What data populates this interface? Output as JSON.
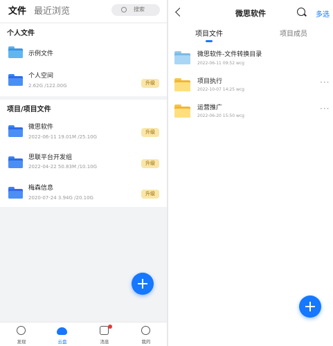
{
  "left": {
    "tabs": {
      "active": "文件",
      "inactive": "最近浏览"
    },
    "search": {
      "label": "搜索"
    },
    "personal": {
      "title": "个人文件",
      "items": [
        {
          "name": "示例文件"
        },
        {
          "name": "个人空间",
          "meta": "2.62G /122.00G",
          "badge": "升级"
        }
      ]
    },
    "projects": {
      "title": "项目/项目文件",
      "items": [
        {
          "name": "微思软件",
          "meta": "2022-06-11  19.01M /25.10G",
          "badge": "升级"
        },
        {
          "name": "思联平台开发组",
          "meta": "2022-04-22  50.83M /10.10G",
          "badge": "升级"
        },
        {
          "name": "梅森信息",
          "meta": "2020-07-24  3.94G /20.10G",
          "badge": "升级"
        }
      ]
    },
    "nav": [
      {
        "label": "发现",
        "icon": "compass-icon"
      },
      {
        "label": "云盘",
        "icon": "cloud-icon",
        "active": true
      },
      {
        "label": "消息",
        "icon": "message-icon"
      },
      {
        "label": "我的",
        "icon": "profile-icon"
      }
    ]
  },
  "right": {
    "title": "微思软件",
    "multi_select": "多选",
    "tabs": {
      "active": "项目文件",
      "inactive": "项目成员"
    },
    "items": [
      {
        "name": "微思软件-文件转换目录",
        "meta": "2022-06-11 09:52 wcg",
        "color": "light-blue"
      },
      {
        "name": "项目执行",
        "meta": "2022-10-07 14:25 wcg",
        "color": "yellow"
      },
      {
        "name": "运营推广",
        "meta": "2022-06-20 15:50 wcg",
        "color": "yellow"
      }
    ]
  },
  "colors": {
    "accent": "#1677ff",
    "badge_bg": "#f9e6a8",
    "badge_text": "#9a6a08"
  }
}
